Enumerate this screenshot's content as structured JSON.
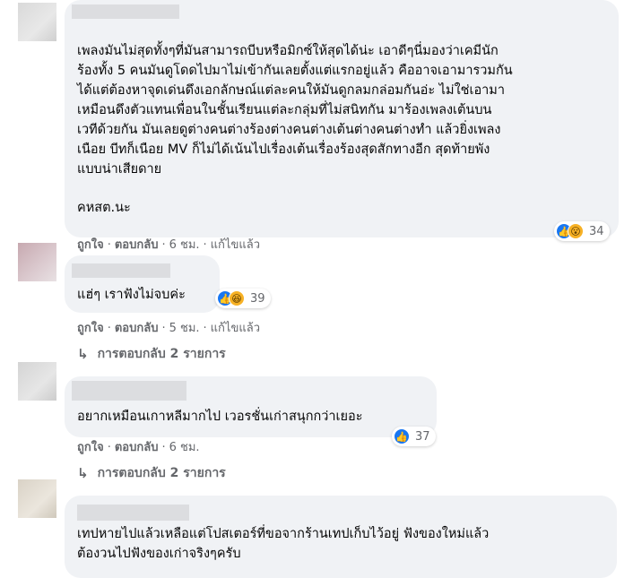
{
  "comments": [
    {
      "lines": [
        "เพลงมันไม่สุดทั้งๆที่มันสามารถบีบหรือมิกซ์ให้สุดได้น่ะ เอาดีๆนี่มองว่าเคมีนัก",
        "ร้องทั้ง 5 คนมันดูโดดไปมาไม่เข้ากันเลยตั้งแต่แรกอยู่แล้ว คืออาจเอามารวมกัน",
        "ได้แต่ต้องหาจุดเด่นดึงเอกลักษณ์แต่ละคนให้มันดูกลมกล่อมกันอ่ะ ไม่ใช่เอามา",
        "เหมือนดึงตัวแทนเพื่อนในชั้นเรียนแต่ละกลุ่มที่ไม่สนิทกัน มาร้องเพลงเต้นบน",
        "เวทีด้วยกัน มันเลยดูต่างคนต่างร้องต่างคนต่างเต้นต่างคนต่างทำ แล้วยิ่งเพลง",
        "เนือย บีทก็เนือย MV ก็ไม่ได้เน้นไปเรื่องเต้นเรื่องร้องสุดสักทางอีก สุดท้ายพัง",
        "แบบน่าเสียดาย"
      ],
      "signature": "คหสต.นะ",
      "reaction_count": "34",
      "actions": {
        "like": "ถูกใจ",
        "reply": "ตอบกลับ",
        "time": "6 ชม.",
        "edited": "แก้ไขแล้ว"
      }
    },
    {
      "lines": [
        "แฮ่ๆ เราฟังไม่จบค่ะ"
      ],
      "reaction_count": "39",
      "actions": {
        "like": "ถูกใจ",
        "reply": "ตอบกลับ",
        "time": "5 ชม.",
        "edited": "แก้ไขแล้ว"
      },
      "replies_label": "การตอบกลับ 2 รายการ"
    },
    {
      "lines": [
        "อยากเหมือนเกาหลีมากไป เวอรชั่นเก่าสนุกกว่าเยอะ"
      ],
      "reaction_count": "37",
      "actions": {
        "like": "ถูกใจ",
        "reply": "ตอบกลับ",
        "time": "6 ชม."
      },
      "replies_label": "การตอบกลับ 2 รายการ"
    },
    {
      "lines": [
        "เทปหายไปแล้วเหลือแต่โปสเตอร์ที่ขอจากร้านเทปเก็บไว้อยู่ ฟังของใหม่แล้ว",
        "ต้องวนไปฟังของเก่าจริงๆครับ"
      ]
    }
  ],
  "glyphs": {
    "sep": "·",
    "reply_arrow": "↳",
    "like": "👍",
    "wow": "😮",
    "haha": "😆"
  },
  "colors": {
    "bubble": "#f0f2f5",
    "like_blue": "#1877f2",
    "meta_gray": "#65676b"
  }
}
